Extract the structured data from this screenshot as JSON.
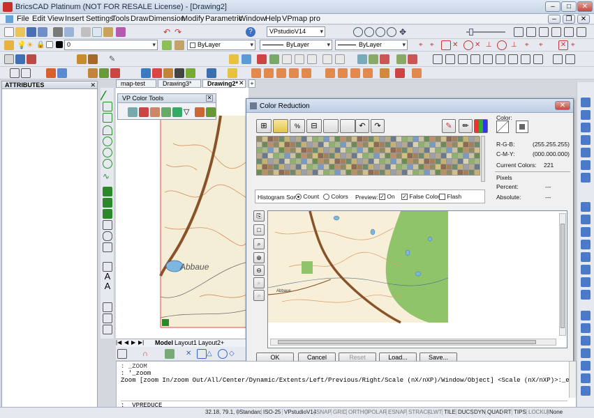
{
  "window": {
    "title": "BricsCAD Platinum (NOT FOR RESALE License) - [Drawing2]"
  },
  "menu": [
    "File",
    "Edit",
    "View",
    "Insert",
    "Settings",
    "Tools",
    "Draw",
    "Dimension",
    "Modify",
    "Parametric",
    "Window",
    "Help",
    "VPmap pro"
  ],
  "toolbar": {
    "layer_value": "0",
    "vpstudio_combo": "VPstudioV14",
    "color_combo": "ByLayer",
    "linetype_combo": "ByLayer",
    "lineweight_combo": "ByLayer"
  },
  "attributes_panel": {
    "title": "ATTRIBUTES"
  },
  "tabs": [
    "map-test",
    "Drawing3*",
    "Drawing2*"
  ],
  "vp_color_tools": {
    "title": "VP Color Tools"
  },
  "map": {
    "label": "Abbaue",
    "preview_label": "Abbaue"
  },
  "dialog": {
    "title": "Color Reduction",
    "color_label": "Color:",
    "rgb_label": "R-G-B:",
    "rgb_value": "(255.255.255)",
    "cmy_label": "C-M-Y:",
    "cmy_value": "(000.000.000)",
    "current_colors_label": "Current Colors:",
    "current_colors_value": "221",
    "pixels_label": "Pixels",
    "percent_label": "Percent:",
    "percent_value": "---",
    "absolute_label": "Absolute:",
    "absolute_value": "---",
    "histogram_label": "Histogram Sort:",
    "sort_count": "Count",
    "sort_colors": "Colors",
    "preview_label": "Preview:",
    "opt_on": "On",
    "opt_false_color": "False Color",
    "opt_flash": "Flash",
    "buttons": {
      "ok": "OK",
      "cancel": "Cancel",
      "reset": "Reset",
      "load": "Load...",
      "save": "Save..."
    }
  },
  "layout_tabs": [
    "Model",
    "Layout1",
    "Layout2"
  ],
  "command": {
    "line1": ": _ZOOM",
    "line2": ": '_zoom",
    "line3": "Zoom [zoom In/zoom Out/All/Center/Dynamic/Extents/Left/Previous/Right/Scale (nX/nXP)/Window/Object] <Scale (nX/nXP)>:_e",
    "prompt": ": _VPREDUCE"
  },
  "status": {
    "coords": "32.18, 79.1, 0",
    "items": [
      "Standard",
      "ISO-25",
      "VPstudioV14",
      "SNAP",
      "GRID",
      "ORTHO",
      "POLAR",
      "ESNAP",
      "STRACK",
      "LWT",
      "TILE",
      "DUCS",
      "DYN",
      "QUAD",
      "RT",
      "TIPS",
      "LOCKUI",
      "None"
    ]
  }
}
